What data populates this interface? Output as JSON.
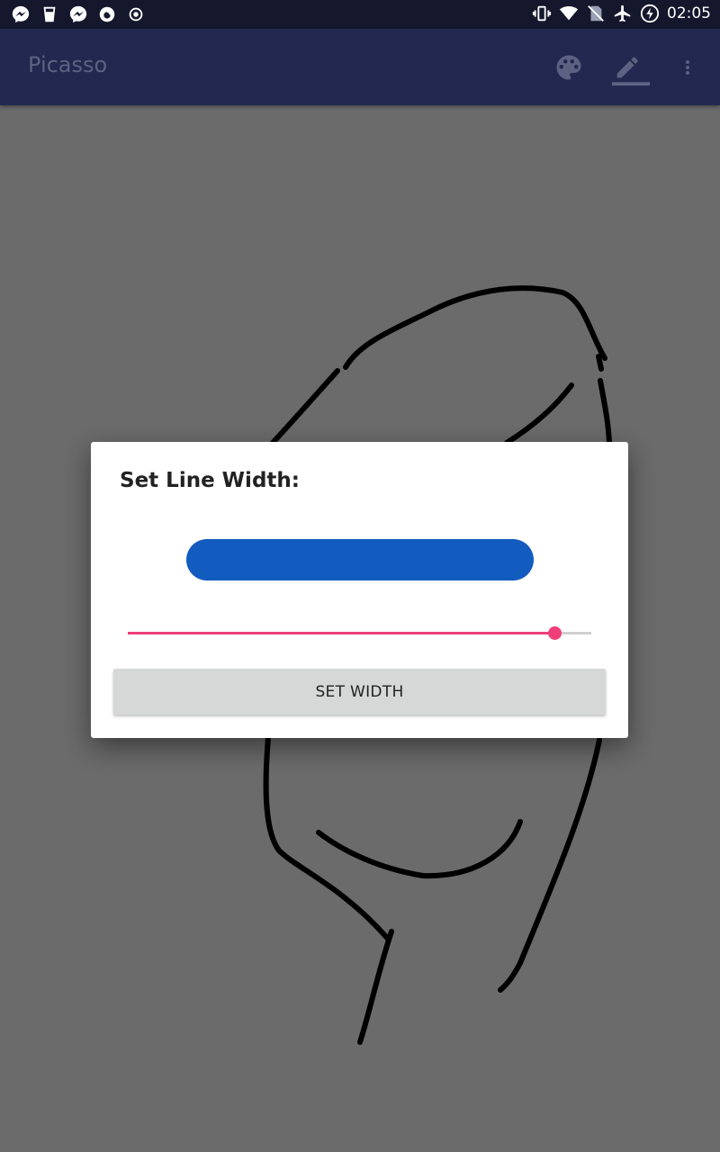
{
  "status_bar": {
    "time": "02:05",
    "left_icons": [
      "messenger-icon",
      "glass-icon",
      "messenger-icon",
      "chat-bubble-icon",
      "record-icon"
    ],
    "right_icons": [
      "vibrate-icon",
      "wifi-icon",
      "no-sim-icon",
      "airplane-icon",
      "battery-saver-icon"
    ]
  },
  "app_bar": {
    "title": "Picasso",
    "actions": [
      "palette-icon",
      "pen-icon",
      "overflow-menu-icon"
    ]
  },
  "dialog": {
    "title": "Set Line Width:",
    "preview_color": "#125bbf",
    "slider": {
      "value_fraction": 0.92,
      "accent_color": "#ef3f79"
    },
    "button_label": "SET WIDTH"
  },
  "colors": {
    "status_bar": "#15182c",
    "app_bar": "#22284f",
    "canvas": "#6b6b6b",
    "dialog_button": "#d6d7d7"
  }
}
